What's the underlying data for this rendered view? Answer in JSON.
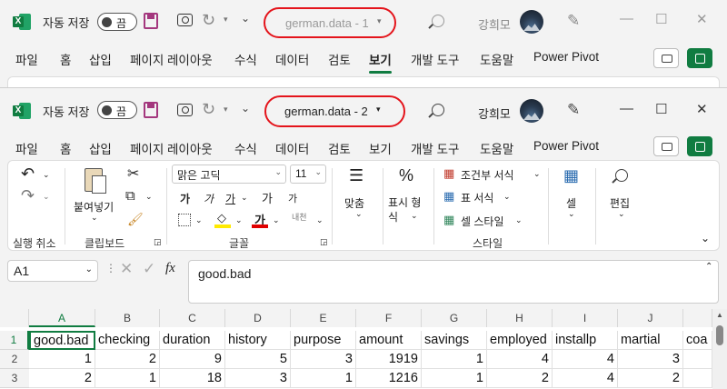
{
  "window1": {
    "autosave_label": "자동 저장",
    "toggle_label": "끔",
    "doc_title": "german.data  -  1",
    "username": "강희모",
    "tabs": [
      "파일",
      "홈",
      "삽입",
      "페이지 레이아웃",
      "수식",
      "데이터",
      "검토",
      "보기",
      "개발 도구",
      "도움말",
      "Power Pivot"
    ],
    "active_tab": "보기"
  },
  "window2": {
    "autosave_label": "자동 저장",
    "toggle_label": "끔",
    "doc_title": "german.data  -  2",
    "username": "강희모",
    "tabs": [
      "파일",
      "홈",
      "삽입",
      "페이지 레이아웃",
      "수식",
      "데이터",
      "검토",
      "보기",
      "개발 도구",
      "도움말",
      "Power Pivot"
    ],
    "active_tab": "홈"
  },
  "ribbon": {
    "undo_group": "실행 취소",
    "clipboard_group": "클립보드",
    "paste_label": "붙여넣기",
    "font_name": "맑은 고딕",
    "font_size": "11",
    "font_group": "글꼴",
    "align_label": "맞춤",
    "number_format_label": "표시 형식",
    "cond_format": "조건부 서식",
    "table_format": "표 서식",
    "cell_style": "셀 스타일",
    "style_group": "스타일",
    "cells_label": "셀",
    "edit_label": "편집",
    "font_glyphs": [
      "가",
      "가",
      "가",
      "가",
      "가"
    ],
    "phonetic": "내천"
  },
  "formula_bar": {
    "name_box": "A1",
    "fx": "fx",
    "content": "good.bad"
  },
  "sheet": {
    "columns": [
      "A",
      "B",
      "C",
      "D",
      "E",
      "F",
      "G",
      "H",
      "I",
      "J"
    ],
    "rows": [
      [
        "good.bad",
        "checking",
        "duration",
        "history",
        "purpose",
        "amount",
        "savings",
        "employed",
        "installp",
        "martial",
        "coa"
      ],
      [
        "1",
        "2",
        "9",
        "5",
        "3",
        "1919",
        "1",
        "4",
        "4",
        "3",
        ""
      ],
      [
        "2",
        "1",
        "18",
        "3",
        "1",
        "1216",
        "1",
        "2",
        "4",
        "2",
        ""
      ]
    ],
    "row_numbers": [
      "1",
      "2",
      "3"
    ]
  }
}
